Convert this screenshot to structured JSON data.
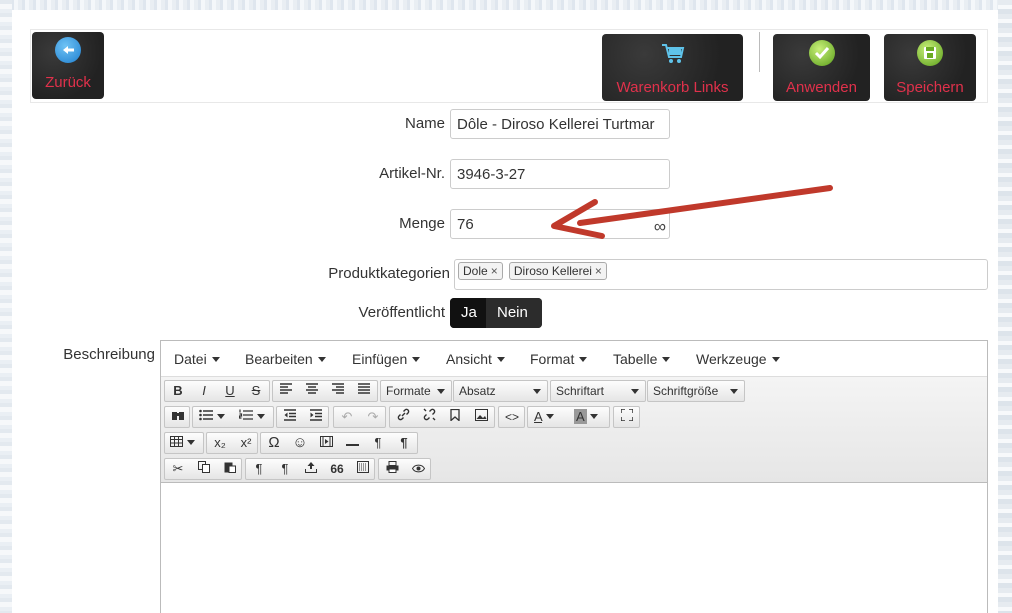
{
  "toolbar": {
    "back_label": "Zurück",
    "cart_label": "Warenkorb Links",
    "apply_label": "Anwenden",
    "save_label": "Speichern",
    "accent_color": "#e0314b"
  },
  "form": {
    "name_label": "Name",
    "name_value": "Dôle - Diroso Kellerei Turtmar",
    "article_label": "Artikel-Nr.",
    "article_value": "3946-3-27",
    "quantity_label": "Menge",
    "quantity_value": "76",
    "quantity_suffix": "∞",
    "category_label": "Produktkategorien",
    "categories": [
      {
        "label": "Dole",
        "remove": "×"
      },
      {
        "label": "Diroso Kellerei",
        "remove": "×"
      }
    ],
    "published_label": "Veröffentlicht",
    "published_yes": "Ja",
    "published_no": "Nein",
    "description_label": "Beschreibung"
  },
  "editor": {
    "menus": [
      "Datei",
      "Bearbeiten",
      "Einfügen",
      "Ansicht",
      "Format",
      "Tabelle",
      "Werkzeuge"
    ],
    "dropdowns": [
      "Formate",
      "Absatz",
      "Schriftart",
      "Schriftgröße"
    ],
    "format_buttons": {
      "bold": "B",
      "italic": "I",
      "underline": "U",
      "strike": "S"
    },
    "row3": {
      "subscript": "x₂",
      "superscript": "x²",
      "omega": "Ω",
      "smiley": "☺",
      "pilcrow": "¶"
    },
    "row4": {
      "pilcrow": "¶",
      "quote": "66"
    }
  }
}
